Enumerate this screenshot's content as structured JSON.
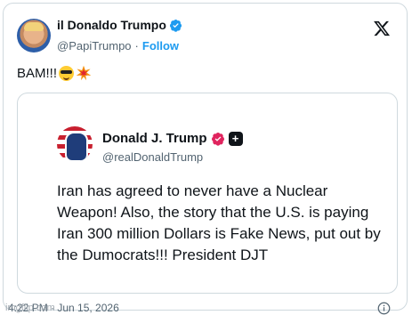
{
  "author": {
    "name": "il Donaldo Trumpo",
    "handle": "@PapiTrumpo",
    "separator": "·",
    "follow_label": "Follow"
  },
  "post": {
    "text": "BAM!!!"
  },
  "quoted": {
    "name": "Donald J. Trump",
    "handle": "@realDonaldTrump",
    "body": "Iran has agreed to never have a Nuclear Weapon! Also, the story that the U.S. is paying Iran 300 million Dollars is Fake News, put out by the Dumocrats!!! President DJT"
  },
  "footer": {
    "timestamp": "4:22 PM · Jun 15, 2026",
    "watermark": "imgflip.com"
  },
  "colors": {
    "accent": "#1d9bf0",
    "border": "#cfd9de",
    "muted": "#536471",
    "verified_gold": "#e0245e"
  },
  "icons": [
    "x-logo-icon",
    "verified-icon",
    "sunglasses-emoji-icon",
    "collision-emoji-icon",
    "gold-verified-icon",
    "plus-badge-icon",
    "info-icon"
  ]
}
